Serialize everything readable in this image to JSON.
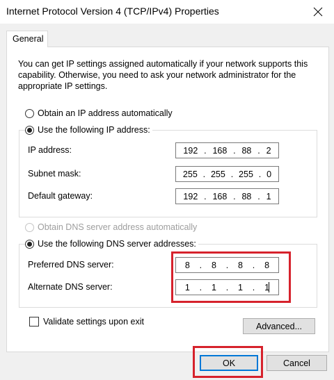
{
  "window": {
    "title": "Internet Protocol Version 4 (TCP/IPv4) Properties",
    "close_icon": "close-icon"
  },
  "tabs": [
    {
      "label": "General",
      "selected": true
    }
  ],
  "intro_text": "You can get IP settings assigned automatically if your network supports this capability. Otherwise, you need to ask your network administrator for the appropriate IP settings.",
  "ip_section": {
    "auto_label": "Obtain an IP address automatically",
    "auto_selected": false,
    "manual_label": "Use the following IP address:",
    "manual_selected": true,
    "fields": [
      {
        "label": "IP address:",
        "octets": [
          "192",
          "168",
          "88",
          "2"
        ]
      },
      {
        "label": "Subnet mask:",
        "octets": [
          "255",
          "255",
          "255",
          "0"
        ]
      },
      {
        "label": "Default gateway:",
        "octets": [
          "192",
          "168",
          "88",
          "1"
        ]
      }
    ]
  },
  "dns_section": {
    "auto_label": "Obtain DNS server address automatically",
    "auto_selected": false,
    "auto_disabled": true,
    "manual_label": "Use the following DNS server addresses:",
    "manual_selected": true,
    "fields": [
      {
        "label": "Preferred DNS server:",
        "octets": [
          "8",
          "8",
          "8",
          "8"
        ]
      },
      {
        "label": "Alternate DNS server:",
        "octets": [
          "1",
          "1",
          "1",
          "1"
        ]
      }
    ]
  },
  "validate_label": "Validate settings upon exit",
  "validate_checked": false,
  "buttons": {
    "advanced": "Advanced...",
    "ok": "OK",
    "cancel": "Cancel"
  },
  "colors": {
    "highlight": "#d6222c",
    "default_button_border": "#0078d7",
    "dialog_background": "#f0f0f0"
  }
}
